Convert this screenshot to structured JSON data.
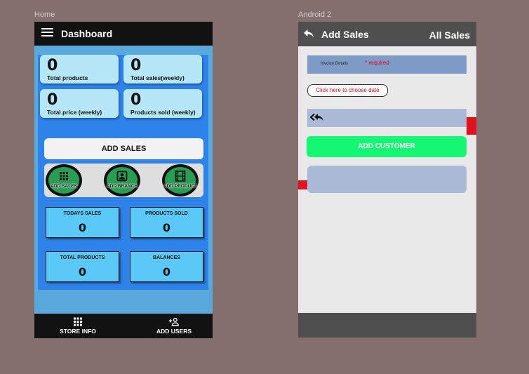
{
  "frames": {
    "home_label": "Home",
    "android2_label": "Android 2"
  },
  "home": {
    "title": "Dashboard",
    "stats": [
      {
        "value": "0",
        "label": "Total products"
      },
      {
        "value": "0",
        "label": "Total sales(weekly)"
      },
      {
        "value": "0",
        "label": "Total price (weekly)"
      },
      {
        "value": "0",
        "label": "Products sold (weekly)"
      }
    ],
    "add_sales_button": "ADD SALES",
    "quick_actions": [
      {
        "label": "ADD SALES",
        "icon": "grid-icon"
      },
      {
        "label": "ADD BRANCH",
        "icon": "person-badge-icon"
      },
      {
        "label": "ADD PRODUCT",
        "icon": "film-icon"
      }
    ],
    "info_cards": [
      {
        "title": "TODAYS SALES",
        "value": "0"
      },
      {
        "title": "PRODUCTS SOLD",
        "value": "0"
      },
      {
        "title": "TOTAL PRODUCTS",
        "value": "0"
      },
      {
        "title": "BALANCES",
        "value": "0"
      }
    ],
    "bottom_nav": [
      {
        "label": "STORE INFO",
        "icon": "grid-icon"
      },
      {
        "label": "ADD USERS",
        "icon": "add-user-icon"
      }
    ]
  },
  "android2": {
    "title": "Add Sales",
    "all_sales": "All Sales",
    "invoice_label": "Invoice Details",
    "required_text": "* required",
    "date_button": "Click here to choose date",
    "add_customer_button": "ADD CUSTOMER"
  },
  "colors": {
    "background": "#846f6f",
    "home_bg": "#5aa9dc",
    "home_panel": "#2e83ea",
    "stat_card": "#b6e7f7",
    "info_card": "#5bc9f7",
    "quick_action": "#2a9d54",
    "add_customer": "#16f675",
    "invoice_bar": "#7f9bc7",
    "customer_bar": "#abbad6",
    "red_accent": "#e2131f",
    "dark_bar": "#121212",
    "grey_bar": "#4f4f4f"
  }
}
